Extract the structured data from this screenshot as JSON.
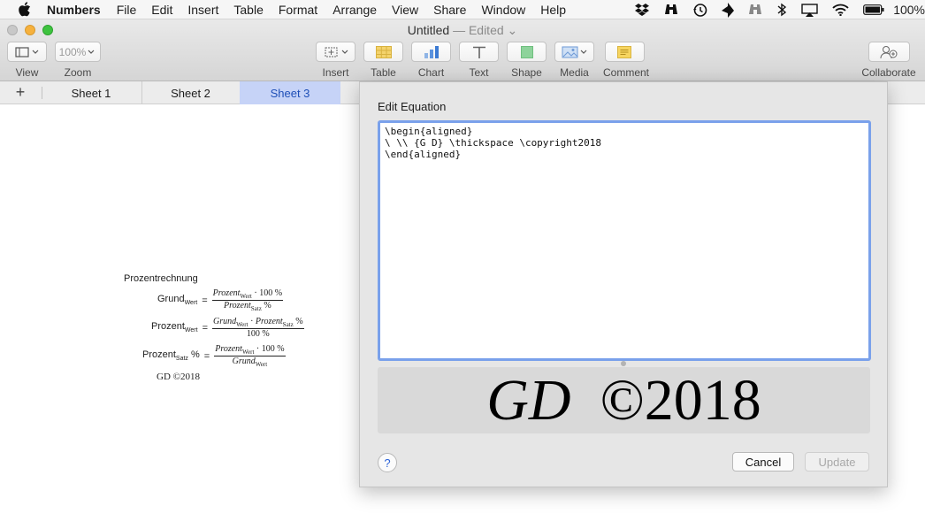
{
  "menubar": {
    "app_name": "Numbers",
    "items": [
      "File",
      "Edit",
      "Insert",
      "Table",
      "Format",
      "Arrange",
      "View",
      "Share",
      "Window",
      "Help"
    ],
    "battery_percent": "100%"
  },
  "window": {
    "title": "Untitled",
    "edited": "— Edited"
  },
  "toolbar": {
    "view_label": "View",
    "zoom_value": "100%",
    "zoom_label": "Zoom",
    "insert_label": "Insert",
    "table_label": "Table",
    "chart_label": "Chart",
    "text_label": "Text",
    "shape_label": "Shape",
    "media_label": "Media",
    "comment_label": "Comment",
    "collaborate_label": "Collaborate"
  },
  "tabs": {
    "add": "+",
    "sheets": [
      "Sheet 1",
      "Sheet 2",
      "Sheet 3"
    ],
    "active": "Sheet 3"
  },
  "canvas": {
    "title": "Prozentrechnung",
    "eq1": {
      "lhs": "Grund",
      "lhs_sub": "Wert",
      "num_a": "Prozent",
      "num_sub": "Wert",
      "num_b": " · 100 %",
      "den_a": "Prozent",
      "den_sub": "Satz",
      "den_b": " %"
    },
    "eq2": {
      "lhs": "Prozent",
      "lhs_sub": "Wert",
      "num_a": "Grund",
      "num_sub": "Wert",
      "num_mid": " · ",
      "num_c": "Prozent",
      "num_sub2": "Satz",
      "num_d": " %",
      "den": "100 %"
    },
    "eq3": {
      "lhs": "Prozent",
      "lhs_sub": "Satz",
      "lhs_b": " %",
      "num_a": "Prozent",
      "num_sub": "Wert",
      "num_b": " · 100 %",
      "den_a": "Grund",
      "den_sub": "Wert"
    },
    "signature": "GD ©2018"
  },
  "dialog": {
    "title": "Edit Equation",
    "latex": "\\begin{aligned}\n\\ \\\\ {G D} \\thickspace \\copyright2018\n\\end{aligned}",
    "preview_gd": "GD",
    "preview_rest": "  ©2018",
    "help": "?",
    "cancel": "Cancel",
    "update": "Update"
  }
}
